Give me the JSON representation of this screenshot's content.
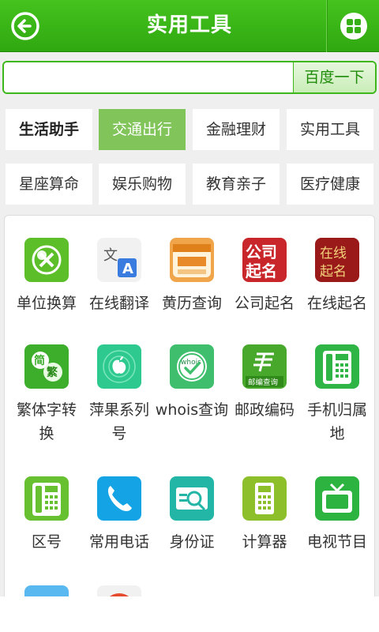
{
  "header": {
    "title": "实用工具",
    "back_icon": "back-arrow-icon",
    "menu_icon": "grid-icon"
  },
  "search": {
    "placeholder": "",
    "value": "",
    "button_label": "百度一下"
  },
  "categories": [
    {
      "label": "生活助手",
      "state": "bold"
    },
    {
      "label": "交通出行",
      "state": "active"
    },
    {
      "label": "金融理财",
      "state": "normal"
    },
    {
      "label": "实用工具",
      "state": "normal"
    },
    {
      "label": "星座算命",
      "state": "normal"
    },
    {
      "label": "娱乐购物",
      "state": "normal"
    },
    {
      "label": "教育亲子",
      "state": "normal"
    },
    {
      "label": "医疗健康",
      "state": "normal"
    }
  ],
  "tools": [
    {
      "label": "单位换算",
      "icon": "unit-convert-icon",
      "color": "#5cbf2a"
    },
    {
      "label": "在线翻译",
      "icon": "translate-icon",
      "color": "#f1f1f1"
    },
    {
      "label": "黄历查询",
      "icon": "almanac-icon",
      "color": "#f0a54a"
    },
    {
      "label": "公司起名",
      "icon": "company-name-icon",
      "color": "#c8262a",
      "icon_text": "公司起名"
    },
    {
      "label": "在线起名",
      "icon": "online-name-icon",
      "color": "#9a1a1a",
      "icon_text": "在线起名"
    },
    {
      "label": "繁体字转换",
      "icon": "traditional-convert-icon",
      "color": "#3cae2c",
      "icon_text": "简繁"
    },
    {
      "label": "萍果系列号",
      "icon": "apple-serial-icon",
      "color": "#2ec98f"
    },
    {
      "label": "whois查询",
      "icon": "whois-icon",
      "color": "#3fbf6e",
      "icon_text": "whois"
    },
    {
      "label": "邮政编码",
      "icon": "postal-code-icon",
      "color": "#48a82c",
      "icon_text": "邮编查询"
    },
    {
      "label": "手机归属地",
      "icon": "phone-location-icon",
      "color": "#2fb545"
    },
    {
      "label": "区号",
      "icon": "area-code-icon",
      "color": "#67c030"
    },
    {
      "label": "常用电话",
      "icon": "common-phone-icon",
      "color": "#14a4e6"
    },
    {
      "label": "身份证",
      "icon": "id-card-icon",
      "color": "#23b5a5"
    },
    {
      "label": "计算器",
      "icon": "calculator-icon",
      "color": "#8cbf2a"
    },
    {
      "label": "电视节目",
      "icon": "tv-icon",
      "color": "#2db33f"
    },
    {
      "label": "",
      "icon": "partial-icon",
      "color": "#5ab8f0"
    },
    {
      "label": "",
      "icon": "partial-icon",
      "color": "#e64a2e"
    }
  ]
}
